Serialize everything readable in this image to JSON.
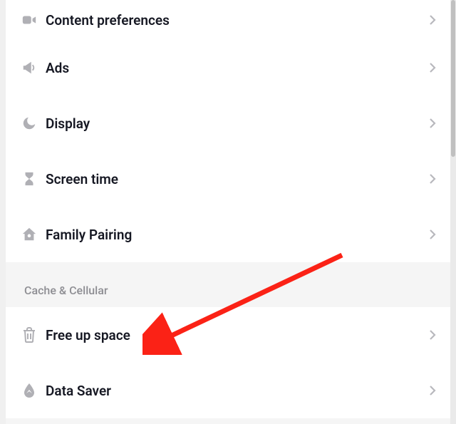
{
  "sections": [
    {
      "title": null,
      "rows": [
        {
          "icon": "video-camera-icon",
          "label": "Content preferences"
        },
        {
          "icon": "megaphone-icon",
          "label": "Ads"
        },
        {
          "icon": "moon-icon",
          "label": "Display"
        },
        {
          "icon": "hourglass-icon",
          "label": "Screen time"
        },
        {
          "icon": "home-icon",
          "label": "Family Pairing"
        }
      ]
    },
    {
      "title": "Cache & Cellular",
      "rows": [
        {
          "icon": "trash-icon",
          "label": "Free up space"
        },
        {
          "icon": "drop-icon",
          "label": "Data Saver"
        }
      ]
    }
  ],
  "icon_color": "#b0b0b5",
  "chevron_color": "#b0b0b5",
  "annotation_color": "#fb2216"
}
